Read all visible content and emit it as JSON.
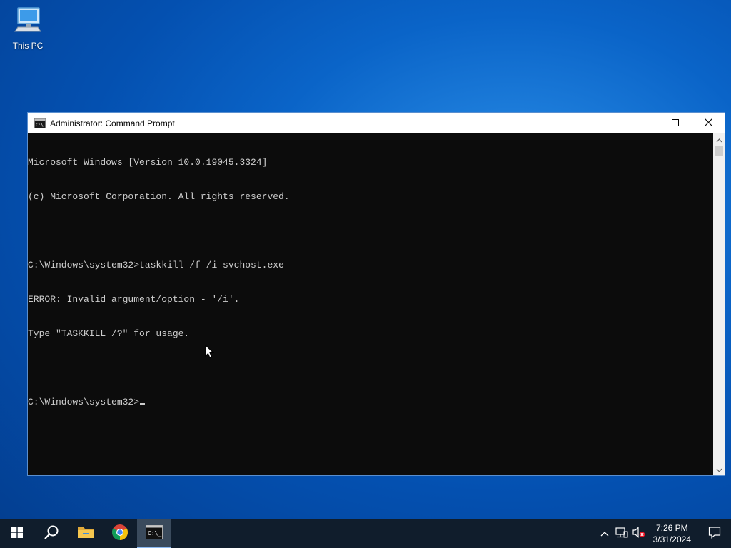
{
  "desktop": {
    "icons": [
      {
        "label": "This PC",
        "icon": "computer-icon"
      }
    ]
  },
  "window": {
    "title": "Administrator: Command Prompt",
    "controls": {
      "minimize": "minimize-icon",
      "maximize": "maximize-icon",
      "close": "close-icon"
    }
  },
  "console": {
    "lines": [
      "Microsoft Windows [Version 10.0.19045.3324]",
      "(c) Microsoft Corporation. All rights reserved.",
      "",
      "C:\\Windows\\system32>taskkill /f /i svchost.exe",
      "ERROR: Invalid argument/option - '/i'.",
      "Type \"TASKKILL /?\" for usage.",
      "",
      "C:\\Windows\\system32>"
    ]
  },
  "taskbar": {
    "items": [
      "windows-start-icon",
      "search-icon",
      "file-explorer-icon",
      "chrome-icon",
      "command-prompt-icon"
    ],
    "active_item": "command-prompt-icon",
    "clock": {
      "time": "7:26 PM",
      "date": "3/31/2024"
    }
  },
  "colors": {
    "console_bg": "#0c0c0c",
    "console_text": "#cccccc",
    "taskbar_bg": "#101d2c",
    "desktop_accent": "#0a64c8"
  }
}
